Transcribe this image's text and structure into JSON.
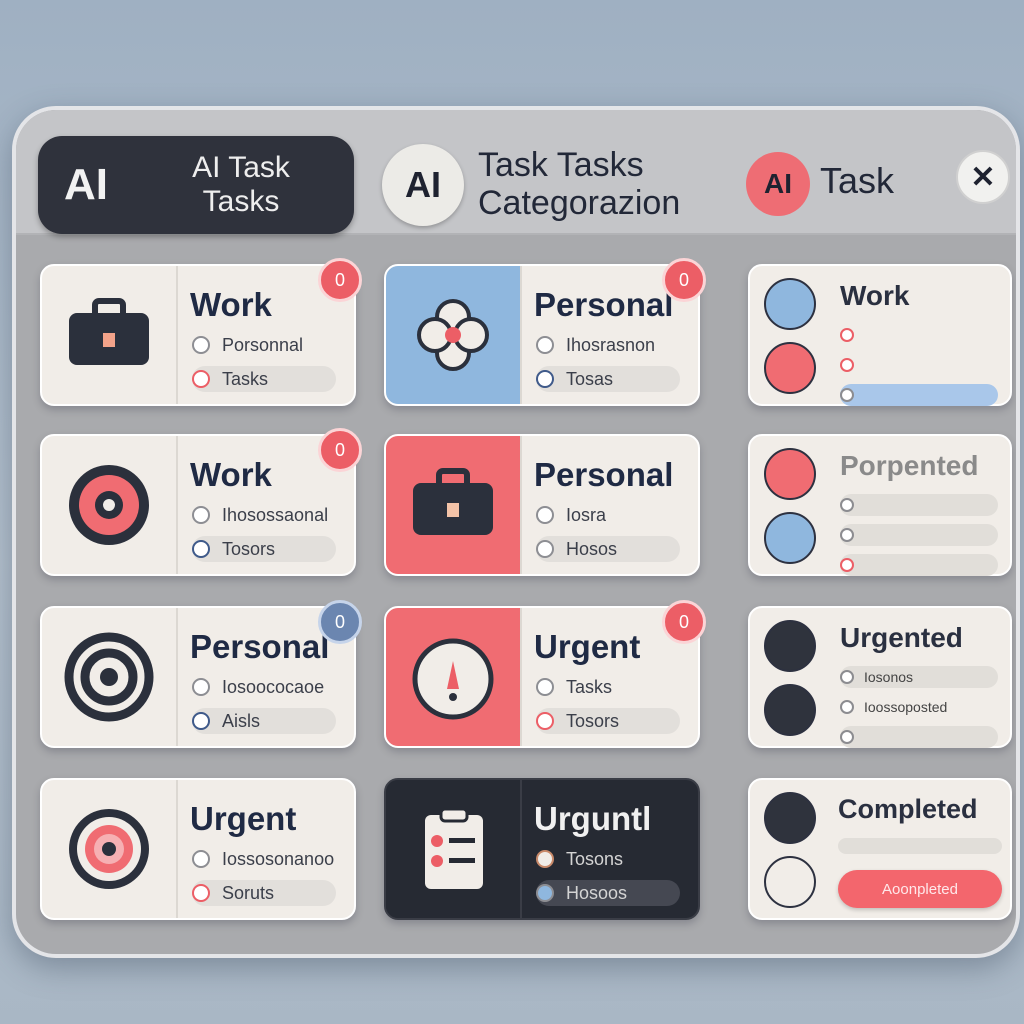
{
  "header": {
    "tab1_logo": "AI",
    "tab1_text_line1": "AI Task",
    "tab1_text_line2": "Tasks",
    "tab2_logo": "AI",
    "tab2_title_line1": "Task Tasks",
    "tab2_title_line2": "Categorazion",
    "tab3_logo": "AI",
    "tab3_title": "Task",
    "close_symbol": "✕"
  },
  "cards": [
    {
      "title": "Work",
      "badge": "0",
      "row1": "Porsonnal",
      "row2": "Tasks",
      "icon": "briefcase-icon"
    },
    {
      "title": "Personal",
      "badge": "0",
      "row1": "Ihosrasnon",
      "row2": "Tosas",
      "icon": "flower-icon"
    },
    {
      "title": "Work",
      "icon": "tasks-list-icon"
    },
    {
      "title": "Work",
      "badge": "0",
      "row1": "Ihosossaonal",
      "row2": "Tosors",
      "icon": "target-icon"
    },
    {
      "title": "Personal",
      "row1": "Iosra",
      "row2": "Hosos",
      "icon": "briefcase-icon"
    },
    {
      "title": "Porpented",
      "icon": "checklist-icon"
    },
    {
      "title": "Personal",
      "badge": "0",
      "row1": "Iosoococaoe",
      "row2": "Aisls",
      "icon": "target-icon"
    },
    {
      "title": "Urgent",
      "badge": "0",
      "row1": "Tasks",
      "row2": "Tosors",
      "icon": "alert-icon"
    },
    {
      "title": "Urgented",
      "row1": "Iosonos",
      "row2": "Ioossoposted",
      "icon": "priority-icon"
    },
    {
      "title": "Urgent",
      "row1": "Iossosonanoo",
      "row2": "Soruts",
      "icon": "target-icon"
    },
    {
      "title": "Urguntl",
      "row1": "Tosons",
      "row2": "Hosoos",
      "icon": "clipboard-icon"
    },
    {
      "title": "Completed",
      "button": "Aoonpleted",
      "icon": "check-icon"
    }
  ],
  "colors": {
    "accent": "#f06c72",
    "dark": "#262a33",
    "blue": "#8fb7de"
  }
}
